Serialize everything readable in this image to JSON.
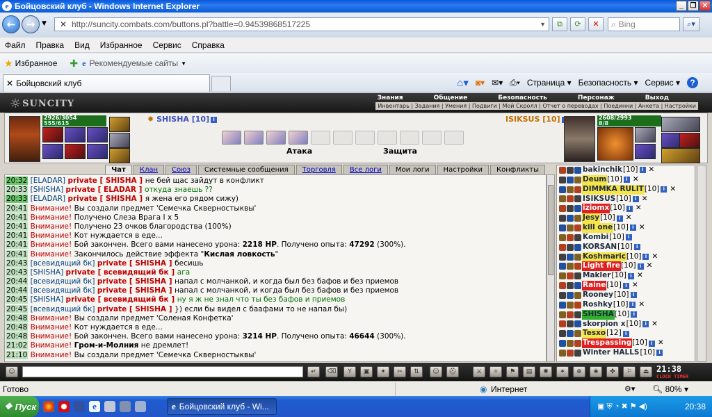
{
  "window": {
    "title": "Бойцовский клуб - Windows Internet Explorer"
  },
  "address": {
    "url": "http://suncity.combats.com/buttons.pl?battle=0.94539868517225",
    "search_placeholder": "Bing"
  },
  "menu": [
    "Файл",
    "Правка",
    "Вид",
    "Избранное",
    "Сервис",
    "Справка"
  ],
  "favorites": {
    "label": "Избранное",
    "suggested": "Рекомендуемые сайты"
  },
  "tab": {
    "title": "Бойцовский клуб"
  },
  "commands": [
    "Страница",
    "Безопасность",
    "Сервис"
  ],
  "game": {
    "logo": "SUNCITY",
    "top_menu": [
      "Знания",
      "Общение",
      "Безопасность",
      "Персонаж",
      "Выход"
    ],
    "sub_menu": "Инвентарь | Задания | Умения | Подвиги | Мой Скролл | Отчет о переводах | Поединки | Анкета | Настройки",
    "player": {
      "name": "SHISHA [10]",
      "hp": "2926/3054",
      "mp": "555/615"
    },
    "enemy": {
      "name": "ISIKSUS [10]",
      "hp": "2608/2993",
      "mp": "8/8"
    },
    "attack_label": "Атака",
    "defense_label": "Защита",
    "chat_tabs": [
      {
        "label": "Чат",
        "style": "act"
      },
      {
        "label": "Клан",
        "style": "link"
      },
      {
        "label": "Союз",
        "style": "link"
      },
      {
        "label": "Системные сообщения",
        "style": ""
      },
      {
        "label": "Торговля",
        "style": "link"
      },
      {
        "label": "Все логи",
        "style": "link"
      },
      {
        "label": "Мои логи",
        "style": ""
      },
      {
        "label": "Настройки",
        "style": ""
      },
      {
        "label": "Конфликты",
        "style": ""
      }
    ],
    "chat": [
      {
        "t": "20:32",
        "hi": true,
        "parts": [
          [
            "n",
            "[ELADAR] "
          ],
          [
            "priv",
            "private [ SHISHA ] "
          ],
          [
            "",
            "не бей щас зайдут в конфликт"
          ]
        ]
      },
      {
        "t": "20:33",
        "hi": false,
        "parts": [
          [
            "n",
            "[SHISHA] "
          ],
          [
            "priv",
            "private [ ELADAR ] "
          ],
          [
            "g",
            "откуда знаешь ??"
          ]
        ]
      },
      {
        "t": "20:33",
        "hi": true,
        "parts": [
          [
            "n",
            "[ELADAR] "
          ],
          [
            "priv",
            "private [ SHISHA ] "
          ],
          [
            "",
            "я жена его рядом сижу)"
          ]
        ]
      },
      {
        "t": "20:41",
        "hi": false,
        "parts": [
          [
            "a",
            "Внимание! "
          ],
          [
            "",
            "Вы создали предмет 'Семечка Скверностыквы'"
          ]
        ]
      },
      {
        "t": "20:41",
        "hi": false,
        "parts": [
          [
            "a",
            "Внимание! "
          ],
          [
            "",
            "Получено Слеза Врага I x 5"
          ]
        ]
      },
      {
        "t": "20:41",
        "hi": false,
        "parts": [
          [
            "a",
            "Внимание! "
          ],
          [
            "",
            "Получено 23 очков благородства (100%)"
          ]
        ]
      },
      {
        "t": "20:41",
        "hi": false,
        "parts": [
          [
            "a",
            "Внимание! "
          ],
          [
            "",
            "Кот нуждается в еде..."
          ]
        ]
      },
      {
        "t": "20:41",
        "hi": false,
        "parts": [
          [
            "a",
            "Внимание! "
          ],
          [
            "",
            "Бой закончен. Всего вами нанесено урона: "
          ],
          [
            "b",
            "2218 HP"
          ],
          [
            "",
            ". Получено опыта: "
          ],
          [
            "b",
            "47292"
          ],
          [
            "",
            " (300%)."
          ]
        ]
      },
      {
        "t": "20:41",
        "hi": false,
        "parts": [
          [
            "a",
            "Внимание! "
          ],
          [
            "",
            "Закончилось действие эффекта \""
          ],
          [
            "b",
            "Кислая ловкость"
          ],
          [
            "",
            "\""
          ]
        ]
      },
      {
        "t": "20:43",
        "hi": false,
        "parts": [
          [
            "n",
            "[всевидящий бк] "
          ],
          [
            "priv",
            "private [ SHISHA ] "
          ],
          [
            "",
            "бесишь"
          ]
        ]
      },
      {
        "t": "20:43",
        "hi": false,
        "parts": [
          [
            "n",
            "[SHISHA] "
          ],
          [
            "priv",
            "private [ всевидящий бк ] "
          ],
          [
            "g",
            "ага"
          ]
        ]
      },
      {
        "t": "20:44",
        "hi": false,
        "parts": [
          [
            "n",
            "[всевидящий бк] "
          ],
          [
            "priv",
            "private [ SHISHA ] "
          ],
          [
            "",
            "напал с молчанкой, и когда был без бафов и без приемов"
          ]
        ]
      },
      {
        "t": "20:44",
        "hi": false,
        "parts": [
          [
            "n",
            "[всевидящий бк] "
          ],
          [
            "priv",
            "private [ SHISHA ] "
          ],
          [
            "",
            "напал с молчанкой, и когда был без бафов и без приемов"
          ]
        ]
      },
      {
        "t": "20:45",
        "hi": false,
        "parts": [
          [
            "n",
            "[SHISHA] "
          ],
          [
            "priv",
            "private [ всевидящий бк ] "
          ],
          [
            "g",
            "ну я ж не знал что ты без бафов и приемов"
          ]
        ]
      },
      {
        "t": "20:45",
        "hi": false,
        "parts": [
          [
            "n",
            "[всевидящий бк] "
          ],
          [
            "priv",
            "private [ SHISHA ] "
          ],
          [
            "",
            "}) если бы видел с баафами то не напал бы)"
          ]
        ]
      },
      {
        "t": "20:48",
        "hi": false,
        "parts": [
          [
            "a",
            "Внимание! "
          ],
          [
            "",
            "Вы создали предмет 'Соленая Конфетка'"
          ]
        ]
      },
      {
        "t": "20:48",
        "hi": false,
        "parts": [
          [
            "a",
            "Внимание! "
          ],
          [
            "",
            "Кот нуждается в еде..."
          ]
        ]
      },
      {
        "t": "20:48",
        "hi": false,
        "parts": [
          [
            "a",
            "Внимание! "
          ],
          [
            "",
            "Бой закончен. Всего вами нанесено урона: "
          ],
          [
            "b",
            "3214 HP"
          ],
          [
            "",
            ". Получено опыта: "
          ],
          [
            "b",
            "46644"
          ],
          [
            "",
            " (300%)."
          ]
        ]
      },
      {
        "t": "21:02",
        "hi": false,
        "parts": [
          [
            "a",
            "Внимание! "
          ],
          [
            "b",
            "Гром-и-Молния"
          ],
          [
            "",
            " не дремлет!"
          ]
        ]
      },
      {
        "t": "21:10",
        "hi": false,
        "parts": [
          [
            "a",
            "Внимание! "
          ],
          [
            "",
            "Вы создали предмет 'Семечка Скверностыквы'"
          ]
        ]
      }
    ],
    "players": [
      {
        "name": "bakinchik",
        "lvl": "[10]",
        "bg": "",
        "x": true
      },
      {
        "name": "Deum",
        "lvl": "[10]",
        "bg": "y",
        "x": true
      },
      {
        "name": "DIMMKA RULIT",
        "lvl": "[10]",
        "bg": "y",
        "x": true
      },
      {
        "name": "ISIKSUS",
        "lvl": "[10]",
        "bg": "",
        "x": true
      },
      {
        "name": "iziomx",
        "lvl": "[10]",
        "bg": "r",
        "x": true
      },
      {
        "name": "Jesy",
        "lvl": "[10]",
        "bg": "y",
        "x": true
      },
      {
        "name": "kill one",
        "lvl": "[10]",
        "bg": "y",
        "x": true
      },
      {
        "name": "Kombi",
        "lvl": "[10]",
        "bg": "",
        "x": false
      },
      {
        "name": "KORSAN",
        "lvl": "[10]",
        "bg": "",
        "x": false
      },
      {
        "name": "Koshmaric",
        "lvl": "[10]",
        "bg": "y",
        "x": true
      },
      {
        "name": "Light fire",
        "lvl": "[10]",
        "bg": "r",
        "x": true
      },
      {
        "name": "Makler",
        "lvl": "[10]",
        "bg": "",
        "x": true
      },
      {
        "name": "Raine",
        "lvl": "[10]",
        "bg": "r",
        "x": true
      },
      {
        "name": "Rooney",
        "lvl": "[10]",
        "bg": "",
        "x": false
      },
      {
        "name": "Roshky",
        "lvl": "[10]",
        "bg": "",
        "x": true
      },
      {
        "name": "SHISHA",
        "lvl": "[10]",
        "bg": "g",
        "x": false
      },
      {
        "name": "skorpion x",
        "lvl": "[10]",
        "bg": "",
        "x": true
      },
      {
        "name": "Tesxo",
        "lvl": "[12]",
        "bg": "y",
        "x": false
      },
      {
        "name": "Trespassing",
        "lvl": "[10]",
        "bg": "r",
        "x": true
      },
      {
        "name": "Winter HALLS",
        "lvl": "[10]",
        "bg": "",
        "x": false
      }
    ],
    "clock": "21:38",
    "clock_sub1": "CLOCK",
    "clock_sub2": "TIMER"
  },
  "status": {
    "left": "Готово",
    "zone": "Интернет",
    "zoom": "80%"
  },
  "taskbar": {
    "start": "Пуск",
    "task": "Бойцовский клуб - Wi...",
    "time": "20:38"
  }
}
